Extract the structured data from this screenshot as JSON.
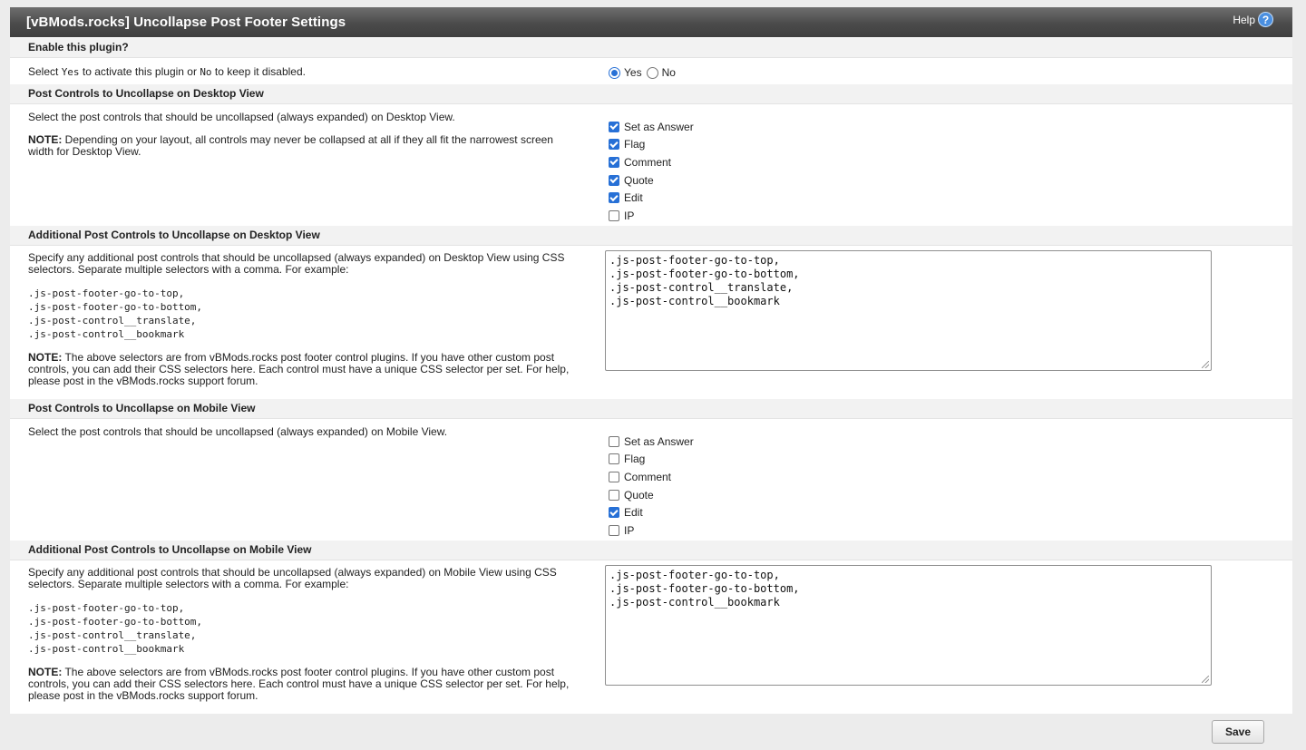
{
  "header": {
    "title": "[vBMods.rocks] Uncollapse Post Footer Settings",
    "help_label": "Help",
    "help_icon": "?"
  },
  "enable": {
    "heading": "Enable this plugin?",
    "desc_pre": "Select ",
    "desc_yes_code": "Yes",
    "desc_mid": " to activate this plugin or ",
    "desc_no_code": "No",
    "desc_post": " to keep it disabled.",
    "options": [
      {
        "label": "Yes",
        "selected": true
      },
      {
        "label": "No",
        "selected": false
      }
    ]
  },
  "desktop": {
    "heading": "Post Controls to Uncollapse on Desktop View",
    "desc": "Select the post controls that should be uncollapsed (always expanded) on Desktop View.",
    "note_label": "NOTE:",
    "note_text": " Depending on your layout, all controls may never be collapsed at all if they all fit the narrowest screen width for Desktop View.",
    "options": [
      {
        "label": "Set as Answer",
        "checked": true
      },
      {
        "label": "Flag",
        "checked": true
      },
      {
        "label": "Comment",
        "checked": true
      },
      {
        "label": "Quote",
        "checked": true
      },
      {
        "label": "Edit",
        "checked": true
      },
      {
        "label": "IP",
        "checked": false
      }
    ]
  },
  "desktop_additional": {
    "heading": "Additional Post Controls to Uncollapse on Desktop View",
    "desc": "Specify any additional post controls that should be uncollapsed (always expanded) on Desktop View using CSS selectors. Separate multiple selectors with a comma. For example:",
    "example": [
      ".js-post-footer-go-to-top,",
      ".js-post-footer-go-to-bottom,",
      ".js-post-control__translate,",
      ".js-post-control__bookmark"
    ],
    "note_label": "NOTE:",
    "note_text": " The above selectors are from vBMods.rocks post footer control plugins. If you have other custom post controls, you can add their CSS selectors here. Each control must have a unique CSS selector per set. For help, please post in the vBMods.rocks support forum.",
    "value": ".js-post-footer-go-to-top,\n.js-post-footer-go-to-bottom,\n.js-post-control__translate,\n.js-post-control__bookmark"
  },
  "mobile": {
    "heading": "Post Controls to Uncollapse on Mobile View",
    "desc": "Select the post controls that should be uncollapsed (always expanded) on Mobile View.",
    "options": [
      {
        "label": "Set as Answer",
        "checked": false
      },
      {
        "label": "Flag",
        "checked": false
      },
      {
        "label": "Comment",
        "checked": false
      },
      {
        "label": "Quote",
        "checked": false
      },
      {
        "label": "Edit",
        "checked": true
      },
      {
        "label": "IP",
        "checked": false
      }
    ]
  },
  "mobile_additional": {
    "heading": "Additional Post Controls to Uncollapse on Mobile View",
    "desc": "Specify any additional post controls that should be uncollapsed (always expanded) on Mobile View using CSS selectors. Separate multiple selectors with a comma. For example:",
    "example": [
      ".js-post-footer-go-to-top,",
      ".js-post-footer-go-to-bottom,",
      ".js-post-control__translate,",
      ".js-post-control__bookmark"
    ],
    "note_label": "NOTE:",
    "note_text": " The above selectors are from vBMods.rocks post footer control plugins. If you have other custom post controls, you can add their CSS selectors here. Each control must have a unique CSS selector per set. For help, please post in the vBMods.rocks support forum.",
    "value": ".js-post-footer-go-to-top,\n.js-post-footer-go-to-bottom,\n.js-post-control__bookmark"
  },
  "footer": {
    "save_label": "Save"
  },
  "colors": {
    "accent": "#2770d6",
    "title_bar": "#4b4b4b",
    "help_icon": "#4a8fe0"
  }
}
